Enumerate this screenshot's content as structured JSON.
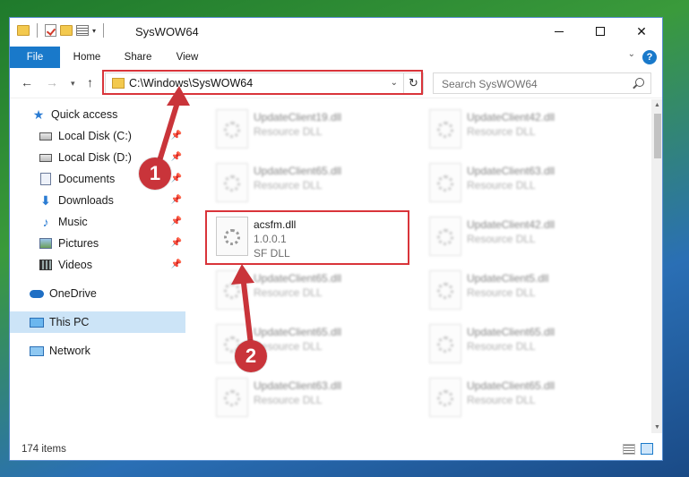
{
  "window": {
    "title": "SysWOW64"
  },
  "ribbon": {
    "tabs": [
      "File",
      "Home",
      "Share",
      "View"
    ]
  },
  "address": {
    "path": "C:\\Windows\\SysWOW64",
    "search_placeholder": "Search SysWOW64"
  },
  "sidebar": {
    "items": [
      {
        "label": "Quick access",
        "icon": "star-icon"
      },
      {
        "label": "Local Disk (C:)",
        "icon": "disk-icon"
      },
      {
        "label": "Local Disk (D:)",
        "icon": "disk-icon"
      },
      {
        "label": "Documents",
        "icon": "documents-icon"
      },
      {
        "label": "Downloads",
        "icon": "download-icon"
      },
      {
        "label": "Music",
        "icon": "music-icon"
      },
      {
        "label": "Pictures",
        "icon": "pictures-icon"
      },
      {
        "label": "Videos",
        "icon": "videos-icon"
      },
      {
        "label": "OneDrive",
        "icon": "cloud-icon"
      },
      {
        "label": "This PC",
        "icon": "computer-icon"
      },
      {
        "label": "Network",
        "icon": "network-icon"
      }
    ]
  },
  "files": {
    "left": [
      {
        "name": "UpdateClient19.dll",
        "type": "Resource DLL"
      },
      {
        "name": "UpdateClient65.dll",
        "type": "Resource DLL"
      },
      {
        "name": "acsfm.dll",
        "version": "1.0.0.1",
        "type": "SF DLL"
      },
      {
        "name": "UpdateClient65.dll",
        "type": "Resource DLL"
      },
      {
        "name": "UpdateClient65.dll",
        "type": "Resource DLL"
      },
      {
        "name": "UpdateClient63.dll",
        "type": "Resource DLL"
      }
    ],
    "right": [
      {
        "name": "UpdateClient42.dll",
        "type": "Resource DLL"
      },
      {
        "name": "UpdateClient63.dll",
        "type": "Resource DLL"
      },
      {
        "name": "UpdateClient42.dll",
        "type": "Resource DLL"
      },
      {
        "name": "UpdateClient5.dll",
        "type": "Resource DLL"
      },
      {
        "name": "UpdateClient65.dll",
        "type": "Resource DLL"
      },
      {
        "name": "UpdateClient65.dll",
        "type": "Resource DLL"
      }
    ]
  },
  "status": {
    "count": "174 items"
  },
  "callouts": [
    "1",
    "2"
  ],
  "colors": {
    "accent": "#1979ca",
    "highlight": "#d9343a",
    "callout": "#c9343a",
    "selected": "#cce4f7"
  }
}
